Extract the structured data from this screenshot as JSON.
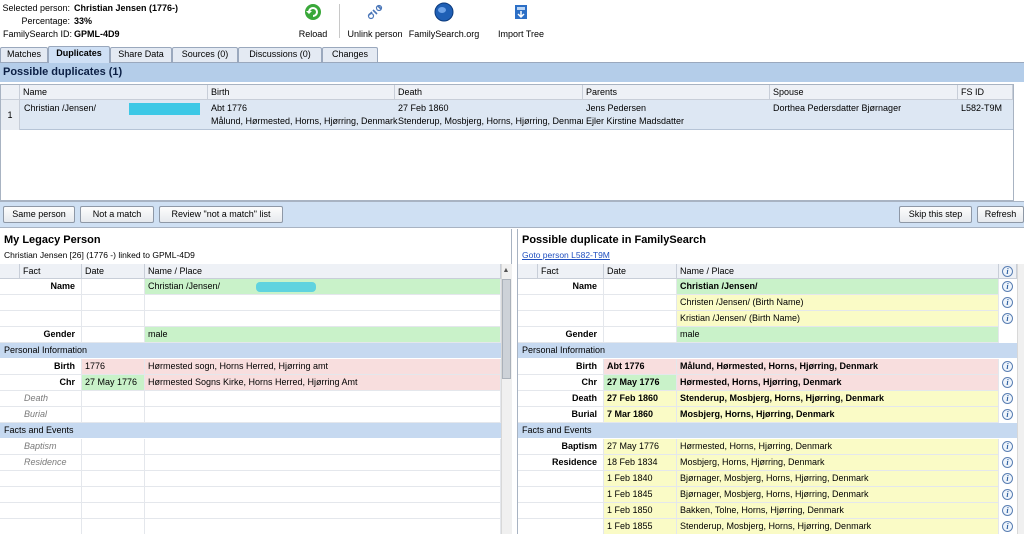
{
  "selected": {
    "person_label": "Selected person:",
    "person_value": "Christian Jensen (1776-)",
    "percentage_label": "Percentage:",
    "percentage_value": "33%",
    "fsid_label": "FamilySearch ID:",
    "fsid_value": "GPML-4D9"
  },
  "toolbar": {
    "reload": "Reload",
    "unlink": "Unlink person",
    "familysearch": "FamilySearch.org",
    "import": "Import Tree"
  },
  "tabs": [
    {
      "label": "Matches"
    },
    {
      "label": "Duplicates"
    },
    {
      "label": "Share Data"
    },
    {
      "label": "Sources (0)"
    },
    {
      "label": "Discussions (0)"
    },
    {
      "label": "Changes"
    }
  ],
  "duplicates": {
    "title": "Possible duplicates (1)",
    "columns": [
      "Name",
      "Birth",
      "Death",
      "Parents",
      "Spouse",
      "FS ID"
    ],
    "row": {
      "index": "1",
      "name": "Christian /Jensen/",
      "birth1": "Abt 1776",
      "birth2": "Målund, Hørmested, Horns, Hjørring, Denmark",
      "death1": "27 Feb 1860",
      "death2": "Stenderup, Mosbjerg, Horns, Hjørring, Denmark",
      "parent1": "Jens Pedersen",
      "parent2": "Ejler Kirstine Madsdatter",
      "spouse": "Dorthea Pedersdatter Bjørnager",
      "fsid": "L582-T9M"
    }
  },
  "buttons": {
    "same": "Same person",
    "not_match": "Not a match",
    "review": "Review \"not a match\" list",
    "skip": "Skip this step",
    "refresh": "Refresh"
  },
  "left": {
    "title": "My Legacy Person",
    "subtitle": "Christian Jensen [26] (1776 -) linked to GPML-4D9",
    "col_fact": "Fact",
    "col_date": "Date",
    "col_name": "Name / Place",
    "name_fact": "Name",
    "name_value": "Christian /Jensen/",
    "gender_fact": "Gender",
    "gender_value": "male",
    "section_personal": "Personal Information",
    "birth_fact": "Birth",
    "birth_date": "1776",
    "birth_place": "Hørmested sogn, Horns Herred, Hjørring amt",
    "chr_fact": "Chr",
    "chr_date": "27 May 1776",
    "chr_place": "Hørmested Sogns Kirke, Horns Herred, Hjørring Amt",
    "death_fact": "Death",
    "burial_fact": "Burial",
    "section_facts": "Facts and Events",
    "baptism_fact": "Baptism",
    "residence_fact": "Residence"
  },
  "right": {
    "title": "Possible duplicate in FamilySearch",
    "goto": "Goto person L582-T9M",
    "col_fact": "Fact",
    "col_date": "Date",
    "col_name": "Name / Place",
    "name_fact": "Name",
    "name_value": "Christian /Jensen/",
    "alt1": "Christen /Jensen/ (Birth Name)",
    "alt2": "Kristian /Jensen/ (Birth Name)",
    "gender_fact": "Gender",
    "gender_value": "male",
    "section_personal": "Personal Information",
    "birth_fact": "Birth",
    "birth_date": "Abt 1776",
    "birth_place": "Målund, Hørmested, Horns, Hjørring, Denmark",
    "chr_fact": "Chr",
    "chr_date": "27 May 1776",
    "chr_place": "Hørmested, Horns, Hjørring, Denmark",
    "death_fact": "Death",
    "death_date": "27 Feb 1860",
    "death_place": "Stenderup, Mosbjerg, Horns, Hjørring, Denmark",
    "burial_fact": "Burial",
    "burial_date": "7 Mar 1860",
    "burial_place": "Mosbjerg, Horns, Hjørring, Denmark",
    "section_facts": "Facts and Events",
    "baptism_fact": "Baptism",
    "baptism_date": "27 May 1776",
    "baptism_place": "Hørmested, Horns, Hjørring, Denmark",
    "residence_fact": "Residence",
    "residences": [
      {
        "date": "18 Feb 1834",
        "place": "Mosbjerg, Horns, Hjørring, Denmark"
      },
      {
        "date": "1 Feb 1840",
        "place": "Bjørnager, Mosbjerg, Horns, Hjørring, Denmark"
      },
      {
        "date": "1 Feb 1845",
        "place": "Bjørnager, Mosbjerg, Horns, Hjørring, Denmark"
      },
      {
        "date": "1 Feb 1850",
        "place": "Bakken, Tolne, Horns, Hjørring, Denmark"
      },
      {
        "date": "1 Feb 1855",
        "place": "Stenderup, Mosbjerg, Horns, Hjørring, Denmark"
      }
    ],
    "info_glyph": "i"
  },
  "colors": {
    "green": "#c9f2c9",
    "pink": "#f8dede",
    "yellow": "#fafbc6",
    "section": "#c6d9f0",
    "redaction": "#3cc8e6"
  }
}
